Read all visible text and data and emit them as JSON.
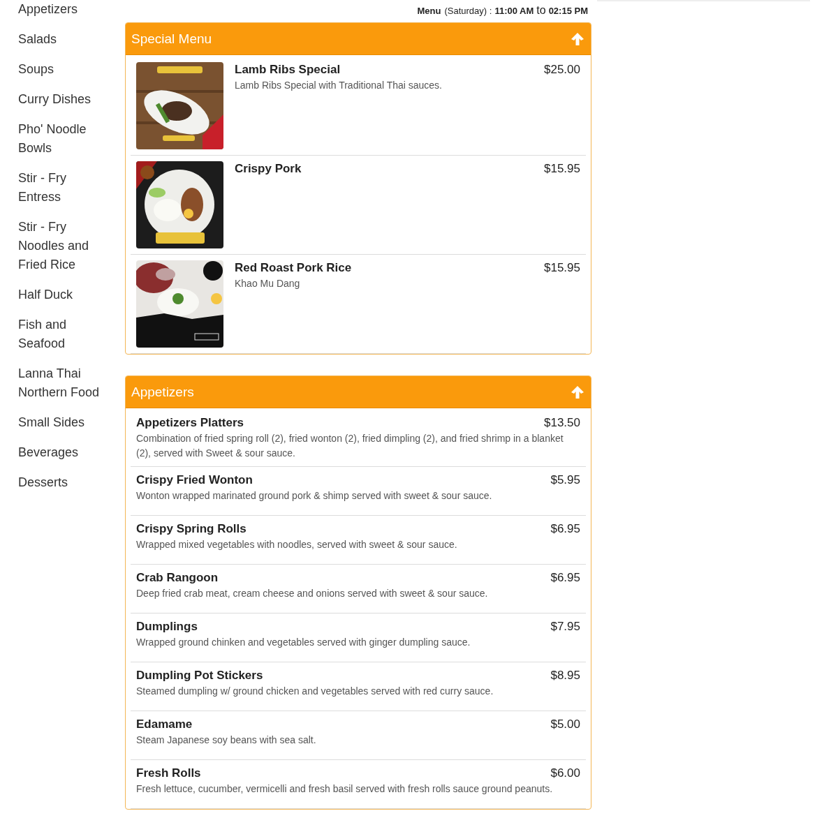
{
  "sidebar": {
    "items": [
      {
        "label": "Appetizers"
      },
      {
        "label": "Salads"
      },
      {
        "label": "Soups"
      },
      {
        "label": "Curry Dishes"
      },
      {
        "label": "Pho' Noodle Bowls"
      },
      {
        "label": "Stir - Fry Entress"
      },
      {
        "label": "Stir - Fry Noodles and Fried Rice"
      },
      {
        "label": "Half Duck"
      },
      {
        "label": "Fish and Seafood"
      },
      {
        "label": "Lanna Thai Northern Food"
      },
      {
        "label": "Small Sides"
      },
      {
        "label": "Beverages"
      },
      {
        "label": "Desserts"
      }
    ]
  },
  "hours": {
    "label": "Menu",
    "day": "(Saturday) :",
    "open": "11:00 AM",
    "to": "to",
    "close": "02:15 PM"
  },
  "sections": [
    {
      "title": "Special Menu",
      "items": [
        {
          "name": "Lamb Ribs Special",
          "price": "$25.00",
          "description": "Lamb Ribs Special with Traditional Thai sauces."
        },
        {
          "name": "Crispy Pork",
          "price": "$15.95"
        },
        {
          "name": "Red Roast Pork Rice",
          "price": "$15.95",
          "description": "Khao Mu Dang"
        }
      ]
    },
    {
      "title": "Appetizers",
      "items": [
        {
          "name": "Appetizers Platters",
          "price": "$13.50",
          "description": "Combination of fried spring roll (2), fried wonton (2), fried dimpling (2), and fried shrimp in a blanket (2), served with Sweet & sour sauce."
        },
        {
          "name": "Crispy Fried Wonton",
          "price": "$5.95",
          "description": "Wonton wrapped marinated ground pork & shimp served with sweet & sour sauce."
        },
        {
          "name": "Crispy Spring Rolls",
          "price": "$6.95",
          "description": "Wrapped mixed vegetables with noodles, served with sweet & sour sauce."
        },
        {
          "name": "Crab Rangoon",
          "price": "$6.95",
          "description": "Deep fried crab meat, cream cheese and onions served with sweet & sour sauce."
        },
        {
          "name": "Dumplings",
          "price": "$7.95",
          "description": "Wrapped ground chinken and vegetables served with ginger dumpling sauce."
        },
        {
          "name": "Dumpling Pot Stickers",
          "price": "$8.95",
          "description": "Steamed dumpling w/ ground chicken and vegetables served with red curry sauce."
        },
        {
          "name": "Edamame",
          "price": "$5.00",
          "description": "Steam Japanese soy beans with sea salt."
        },
        {
          "name": "Fresh Rolls",
          "price": "$6.00",
          "description": "Fresh lettuce, cucumber, vermicelli and fresh basil served with fresh rolls sauce ground peanuts."
        }
      ]
    }
  ]
}
